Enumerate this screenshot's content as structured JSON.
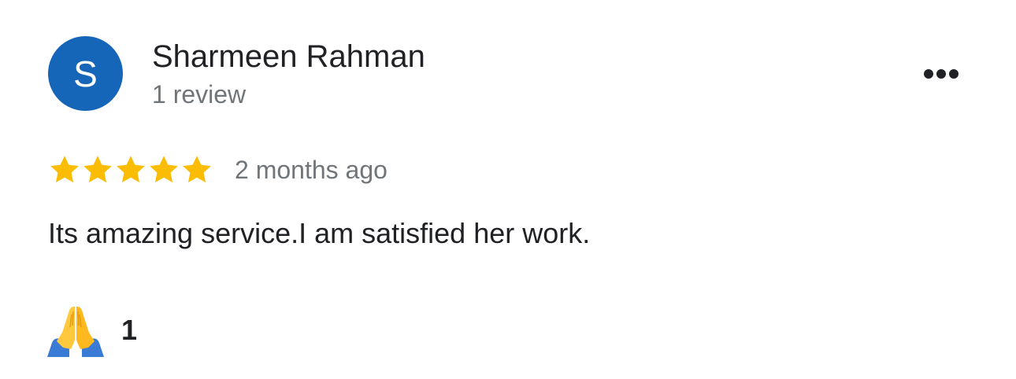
{
  "reviewer": {
    "avatar_initial": "S",
    "avatar_color": "#1565b8",
    "name": "Sharmeen Rahman",
    "review_count_text": "1 review"
  },
  "menu": {
    "icon": "more-horizontal-icon"
  },
  "rating": {
    "stars": 5,
    "max_stars": 5,
    "star_color": "#fbbc04",
    "star_icon": "star-icon",
    "timestamp": "2 months ago"
  },
  "review": {
    "text": "Its amazing service.I am satisfied her work."
  },
  "reaction": {
    "icon": "folded-hands-icon",
    "count": "1"
  }
}
